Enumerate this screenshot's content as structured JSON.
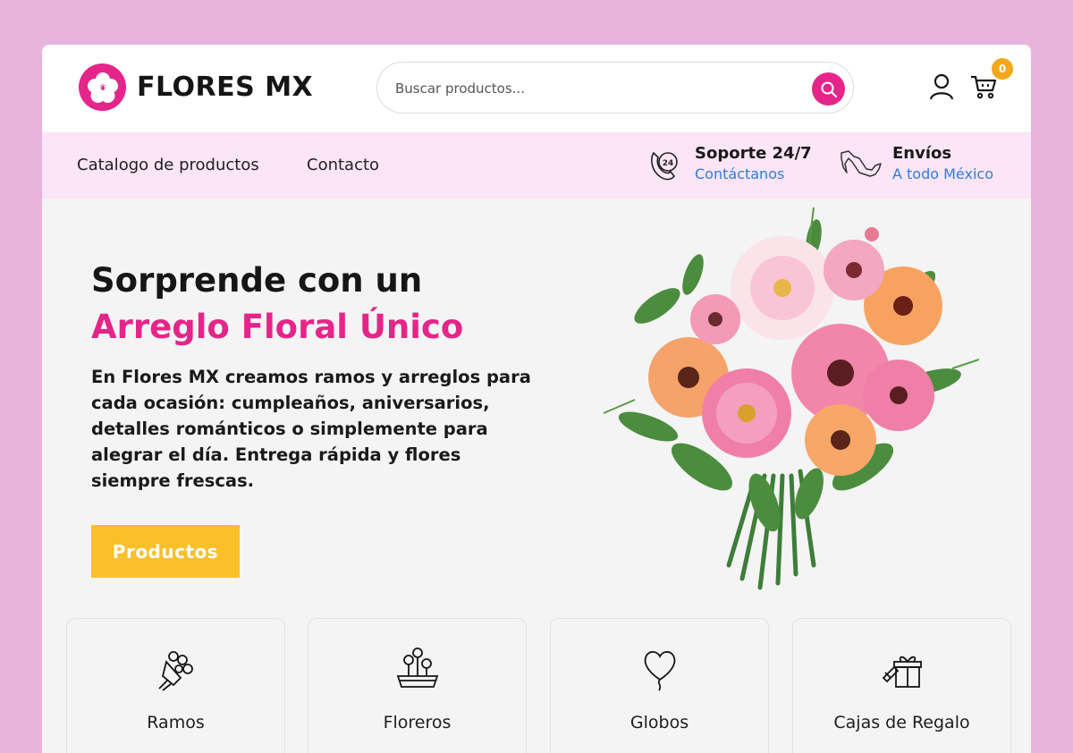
{
  "header": {
    "logo_text": "FLORES MX",
    "search_placeholder": "Buscar productos...",
    "cart_count": "0"
  },
  "nav": {
    "links": [
      "Catalogo de productos",
      "Contacto"
    ],
    "support": {
      "title": "Soporte 24/7",
      "link": "Contáctanos"
    },
    "shipping": {
      "title": "Envíos",
      "link": "A todo México"
    }
  },
  "hero": {
    "title_line1": "Sorprende con un",
    "title_line2": "Arreglo Floral Único",
    "description": "En Flores MX creamos ramos y arreglos para cada ocasión: cumpleaños, aniversarios, detalles románticos o simplemente para alegrar el día. Entrega rápida y flores siempre frescas.",
    "button_label": "Productos"
  },
  "categories": [
    {
      "label": "Ramos",
      "icon": "bouquet-icon"
    },
    {
      "label": "Floreros",
      "icon": "vase-icon"
    },
    {
      "label": "Globos",
      "icon": "balloon-icon"
    },
    {
      "label": "Cajas de Regalo",
      "icon": "gift-box-icon"
    }
  ],
  "colors": {
    "background": "#e8b4dc",
    "brand_pink": "#e5258a",
    "nav_bg": "#fbe5f6",
    "link_blue": "#2d7de0",
    "button_yellow": "#fbbf2a",
    "badge_orange": "#f6a71c"
  }
}
